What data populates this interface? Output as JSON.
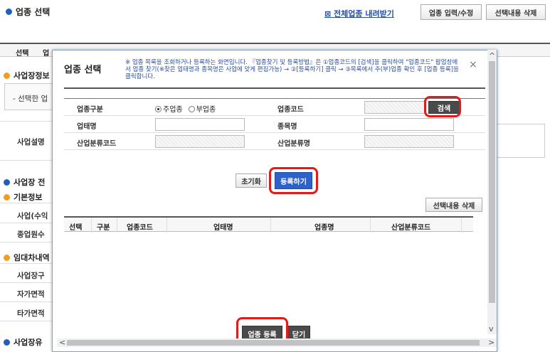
{
  "background": {
    "title": "업종 선택",
    "download_link": "전체업종 내려받기",
    "btn_input_edit": "업종 입력/수정",
    "btn_delete_selected": "선택내용 삭제",
    "table_header": {
      "select": "선택",
      "col2": "업"
    },
    "sections": {
      "business_info": "사업장정보",
      "business_status": "사업장 전",
      "basic_info": "기본정보",
      "rental": "임대차내역",
      "business_bottom": "사업장유"
    },
    "rows": {
      "selected_prefix": "- 선택한 업",
      "description": "사업설명",
      "business_revenue": "사업(수익",
      "employees": "종업원수",
      "business_type": "사업장구",
      "own_area": "자가면적",
      "other_area": "타가면적"
    }
  },
  "modal": {
    "title": "업종 선택",
    "notice": "※ 업종 목록을 조회하거나 등록하는 화면입니다. 『업종찾기 및 등록방법』은 ①업종코드의 [검색]을 클릭하여 \"업종코드\" 팝업창에서 업종 찾기(※찾은 업태명과 종목명은 사업에 맞게 편집가능) → ②[등록하기] 클릭 → ③목록에서 주(부)업종 확인 후 [업종 등록]을 클릭합니다.",
    "close_icon": "×",
    "form": {
      "type_label": "업종구분",
      "radio_main": "주업종",
      "radio_sub": "부업종",
      "code_label": "업종코드",
      "search_button": "검색",
      "business_name_label": "업태명",
      "item_name_label": "종목명",
      "industry_code_label": "산업분류코드",
      "industry_name_label": "산업분류명"
    },
    "reset_button": "초기화",
    "register_button": "등록하기",
    "delete_selected_button": "선택내용 삭제",
    "grid_headers": [
      "선택",
      "구분",
      "업종코드",
      "업태명",
      "업종명",
      "산업분류코드"
    ],
    "submit_button": "업종 등록",
    "close_button": "닫기"
  },
  "colors": {
    "highlight": "#e01b1b",
    "primary_blue": "#2f62c8",
    "notice_text": "#2a4d9b"
  }
}
